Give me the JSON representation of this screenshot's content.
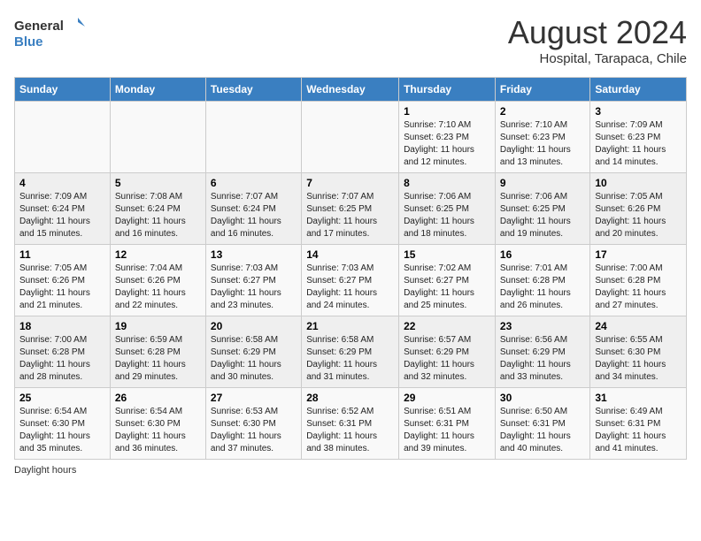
{
  "header": {
    "logo_general": "General",
    "logo_blue": "Blue",
    "month_title": "August 2024",
    "subtitle": "Hospital, Tarapaca, Chile"
  },
  "days_of_week": [
    "Sunday",
    "Monday",
    "Tuesday",
    "Wednesday",
    "Thursday",
    "Friday",
    "Saturday"
  ],
  "weeks": [
    [
      {
        "day": "",
        "info": ""
      },
      {
        "day": "",
        "info": ""
      },
      {
        "day": "",
        "info": ""
      },
      {
        "day": "",
        "info": ""
      },
      {
        "day": "1",
        "info": "Sunrise: 7:10 AM\nSunset: 6:23 PM\nDaylight: 11 hours\nand 12 minutes."
      },
      {
        "day": "2",
        "info": "Sunrise: 7:10 AM\nSunset: 6:23 PM\nDaylight: 11 hours\nand 13 minutes."
      },
      {
        "day": "3",
        "info": "Sunrise: 7:09 AM\nSunset: 6:23 PM\nDaylight: 11 hours\nand 14 minutes."
      }
    ],
    [
      {
        "day": "4",
        "info": "Sunrise: 7:09 AM\nSunset: 6:24 PM\nDaylight: 11 hours\nand 15 minutes."
      },
      {
        "day": "5",
        "info": "Sunrise: 7:08 AM\nSunset: 6:24 PM\nDaylight: 11 hours\nand 16 minutes."
      },
      {
        "day": "6",
        "info": "Sunrise: 7:07 AM\nSunset: 6:24 PM\nDaylight: 11 hours\nand 16 minutes."
      },
      {
        "day": "7",
        "info": "Sunrise: 7:07 AM\nSunset: 6:25 PM\nDaylight: 11 hours\nand 17 minutes."
      },
      {
        "day": "8",
        "info": "Sunrise: 7:06 AM\nSunset: 6:25 PM\nDaylight: 11 hours\nand 18 minutes."
      },
      {
        "day": "9",
        "info": "Sunrise: 7:06 AM\nSunset: 6:25 PM\nDaylight: 11 hours\nand 19 minutes."
      },
      {
        "day": "10",
        "info": "Sunrise: 7:05 AM\nSunset: 6:26 PM\nDaylight: 11 hours\nand 20 minutes."
      }
    ],
    [
      {
        "day": "11",
        "info": "Sunrise: 7:05 AM\nSunset: 6:26 PM\nDaylight: 11 hours\nand 21 minutes."
      },
      {
        "day": "12",
        "info": "Sunrise: 7:04 AM\nSunset: 6:26 PM\nDaylight: 11 hours\nand 22 minutes."
      },
      {
        "day": "13",
        "info": "Sunrise: 7:03 AM\nSunset: 6:27 PM\nDaylight: 11 hours\nand 23 minutes."
      },
      {
        "day": "14",
        "info": "Sunrise: 7:03 AM\nSunset: 6:27 PM\nDaylight: 11 hours\nand 24 minutes."
      },
      {
        "day": "15",
        "info": "Sunrise: 7:02 AM\nSunset: 6:27 PM\nDaylight: 11 hours\nand 25 minutes."
      },
      {
        "day": "16",
        "info": "Sunrise: 7:01 AM\nSunset: 6:28 PM\nDaylight: 11 hours\nand 26 minutes."
      },
      {
        "day": "17",
        "info": "Sunrise: 7:00 AM\nSunset: 6:28 PM\nDaylight: 11 hours\nand 27 minutes."
      }
    ],
    [
      {
        "day": "18",
        "info": "Sunrise: 7:00 AM\nSunset: 6:28 PM\nDaylight: 11 hours\nand 28 minutes."
      },
      {
        "day": "19",
        "info": "Sunrise: 6:59 AM\nSunset: 6:28 PM\nDaylight: 11 hours\nand 29 minutes."
      },
      {
        "day": "20",
        "info": "Sunrise: 6:58 AM\nSunset: 6:29 PM\nDaylight: 11 hours\nand 30 minutes."
      },
      {
        "day": "21",
        "info": "Sunrise: 6:58 AM\nSunset: 6:29 PM\nDaylight: 11 hours\nand 31 minutes."
      },
      {
        "day": "22",
        "info": "Sunrise: 6:57 AM\nSunset: 6:29 PM\nDaylight: 11 hours\nand 32 minutes."
      },
      {
        "day": "23",
        "info": "Sunrise: 6:56 AM\nSunset: 6:29 PM\nDaylight: 11 hours\nand 33 minutes."
      },
      {
        "day": "24",
        "info": "Sunrise: 6:55 AM\nSunset: 6:30 PM\nDaylight: 11 hours\nand 34 minutes."
      }
    ],
    [
      {
        "day": "25",
        "info": "Sunrise: 6:54 AM\nSunset: 6:30 PM\nDaylight: 11 hours\nand 35 minutes."
      },
      {
        "day": "26",
        "info": "Sunrise: 6:54 AM\nSunset: 6:30 PM\nDaylight: 11 hours\nand 36 minutes."
      },
      {
        "day": "27",
        "info": "Sunrise: 6:53 AM\nSunset: 6:30 PM\nDaylight: 11 hours\nand 37 minutes."
      },
      {
        "day": "28",
        "info": "Sunrise: 6:52 AM\nSunset: 6:31 PM\nDaylight: 11 hours\nand 38 minutes."
      },
      {
        "day": "29",
        "info": "Sunrise: 6:51 AM\nSunset: 6:31 PM\nDaylight: 11 hours\nand 39 minutes."
      },
      {
        "day": "30",
        "info": "Sunrise: 6:50 AM\nSunset: 6:31 PM\nDaylight: 11 hours\nand 40 minutes."
      },
      {
        "day": "31",
        "info": "Sunrise: 6:49 AM\nSunset: 6:31 PM\nDaylight: 11 hours\nand 41 minutes."
      }
    ]
  ],
  "footer": {
    "note": "Daylight hours"
  },
  "colors": {
    "header_bg": "#3a7fc1",
    "header_text": "#ffffff",
    "odd_row": "#f9f9f9",
    "even_row": "#efefef"
  }
}
